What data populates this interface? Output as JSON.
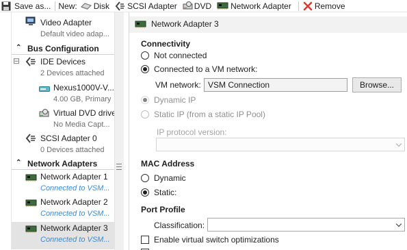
{
  "toolbar": {
    "save_label": "Save as...",
    "new_label": "New:",
    "disk_label": "Disk",
    "scsi_label": "SCSI Adapter",
    "dvd_label": "DVD",
    "netadapter_label": "Network Adapter",
    "remove_label": "Remove"
  },
  "sidebar": {
    "video": {
      "title": "Video Adapter",
      "subtitle": "Default video adap..."
    },
    "bus_section": "Bus Configuration",
    "ide": {
      "title": "IDE Devices",
      "subtitle": "2 Devices attached",
      "collapse": "⊟"
    },
    "disk": {
      "title": "Nexus1000V-V...",
      "subtitle": "4.00 GB, Primary"
    },
    "dvd": {
      "title": "Virtual DVD drive",
      "subtitle": "No Media Capt..."
    },
    "scsi": {
      "title": "SCSI Adapter 0",
      "subtitle": "0 Devices attached"
    },
    "net_section": "Network Adapters",
    "adapters": [
      {
        "title": "Network Adapter 1",
        "subtitle": "Connected to VSM..."
      },
      {
        "title": "Network Adapter 2",
        "subtitle": "Connected to VSM..."
      },
      {
        "title": "Network Adapter 3",
        "subtitle": "Connected to VSM..."
      }
    ]
  },
  "panel": {
    "header": "Network Adapter 3",
    "connectivity": {
      "heading": "Connectivity",
      "not_connected": "Not connected",
      "connected_vm": "Connected to a VM network:",
      "vm_network_label": "VM network:",
      "vm_network_value": "VSM Connection",
      "browse": "Browse...",
      "dynamic_ip": "Dynamic IP",
      "static_ip": "Static IP (from a static IP Pool)",
      "ip_protocol_label": "IP protocol version:",
      "selected": "connected_vm"
    },
    "mac": {
      "heading": "MAC Address",
      "dynamic": "Dynamic",
      "static": "Static:",
      "selected": "static"
    },
    "port_profile": {
      "heading": "Port Profile",
      "classification_label": "Classification:",
      "classification_value": "",
      "vswitch_opt": "Enable virtual switch optimizations",
      "vswitch_checked": false
    }
  },
  "colors": {
    "link": "#3a8ad6",
    "selected_row": "#e3e3e3",
    "header_bg": "#f2f2f2"
  }
}
